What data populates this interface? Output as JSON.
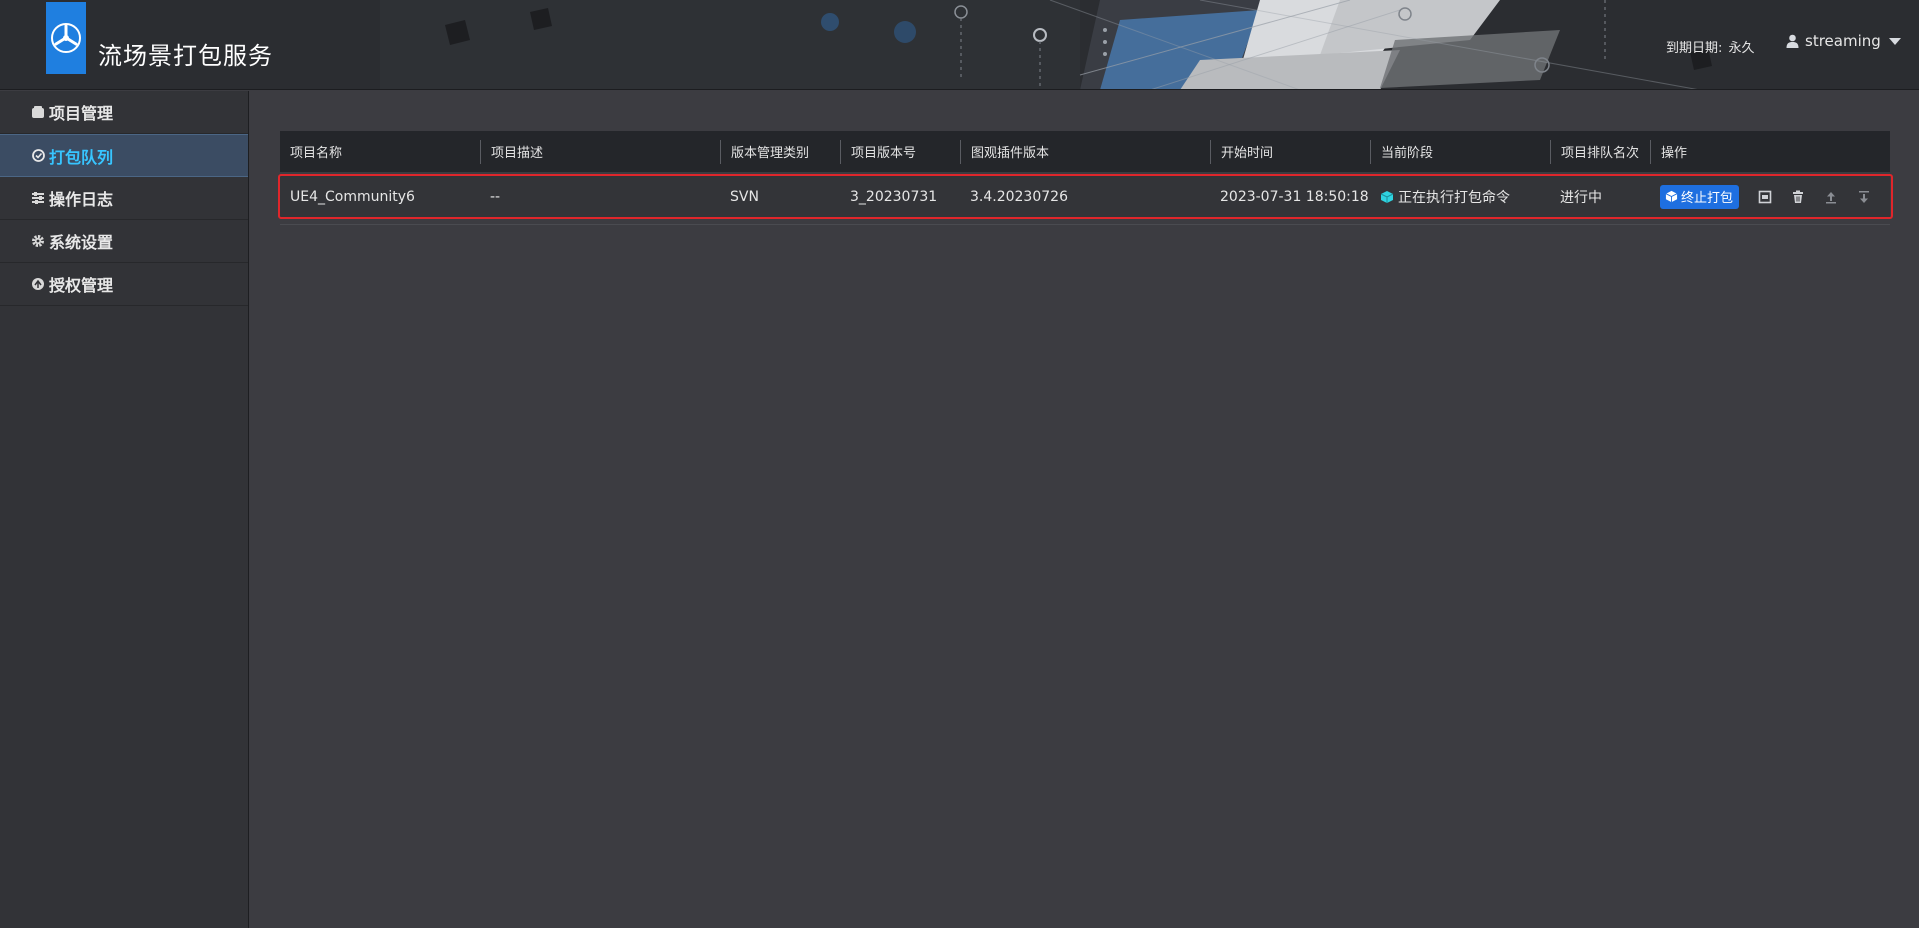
{
  "header": {
    "app_title": "流场景打包服务",
    "expire_label": "到期日期:",
    "expire_value": "永久",
    "username": "streaming"
  },
  "sidebar": {
    "items": [
      {
        "label": "项目管理",
        "icon": "folder-icon",
        "active": false
      },
      {
        "label": "打包队列",
        "icon": "refresh-icon",
        "active": true
      },
      {
        "label": "操作日志",
        "icon": "sliders-icon",
        "active": false
      },
      {
        "label": "系统设置",
        "icon": "gear-icon",
        "active": false
      },
      {
        "label": "授权管理",
        "icon": "shield-icon",
        "active": false
      }
    ]
  },
  "table": {
    "headers": [
      "项目名称",
      "项目描述",
      "版本管理类别",
      "项目版本号",
      "图观插件版本",
      "开始时间",
      "当前阶段",
      "项目排队名次",
      "操作"
    ],
    "rows": [
      {
        "name": "UE4_Community6",
        "description": "--",
        "vcs": "SVN",
        "version": "3_20230731",
        "plugin_version": "3.4.20230726",
        "start_time": "2023-07-31 18:50:18",
        "stage": "正在执行打包命令",
        "queue": "进行中",
        "stop_label": "终止打包"
      }
    ]
  },
  "colors": {
    "accent": "#1e6fe0",
    "active_nav_text": "#37c5ff",
    "highlight": "#e0262b",
    "stage_icon": "#2fd3e0"
  }
}
